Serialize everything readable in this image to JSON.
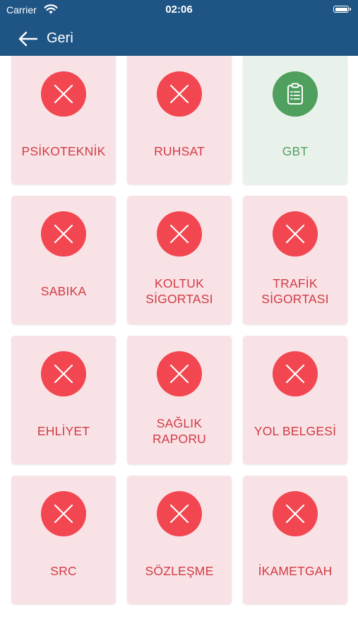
{
  "status_bar": {
    "carrier": "Carrier",
    "time": "02:06"
  },
  "nav": {
    "back_label": "Geri"
  },
  "colors": {
    "header": "#1e5585",
    "tile_missing_bg": "#f9e2e5",
    "tile_missing_icon": "#f24650",
    "tile_missing_text": "#d23a45",
    "tile_ok_bg": "#e9f2ea",
    "tile_ok_icon": "#4f9f5e",
    "tile_ok_text": "#52a061"
  },
  "documents": [
    {
      "label": "PSİKOTEKNİK",
      "status": "missing",
      "icon": "x-icon"
    },
    {
      "label": "RUHSAT",
      "status": "missing",
      "icon": "x-icon"
    },
    {
      "label": "GBT",
      "status": "ok",
      "icon": "clipboard-icon"
    },
    {
      "label": "SABIKA",
      "status": "missing",
      "icon": "x-icon"
    },
    {
      "label": "KOLTUK SİGORTASI",
      "status": "missing",
      "icon": "x-icon"
    },
    {
      "label": "TRAFİK SİGORTASI",
      "status": "missing",
      "icon": "x-icon"
    },
    {
      "label": "EHLİYET",
      "status": "missing",
      "icon": "x-icon"
    },
    {
      "label": "SAĞLIK RAPORU",
      "status": "missing",
      "icon": "x-icon"
    },
    {
      "label": "YOL BELGESİ",
      "status": "missing",
      "icon": "x-icon"
    },
    {
      "label": "SRC",
      "status": "missing",
      "icon": "x-icon"
    },
    {
      "label": "SÖZLEŞME",
      "status": "missing",
      "icon": "x-icon"
    },
    {
      "label": "İKAMETGAH",
      "status": "missing",
      "icon": "x-icon"
    }
  ]
}
